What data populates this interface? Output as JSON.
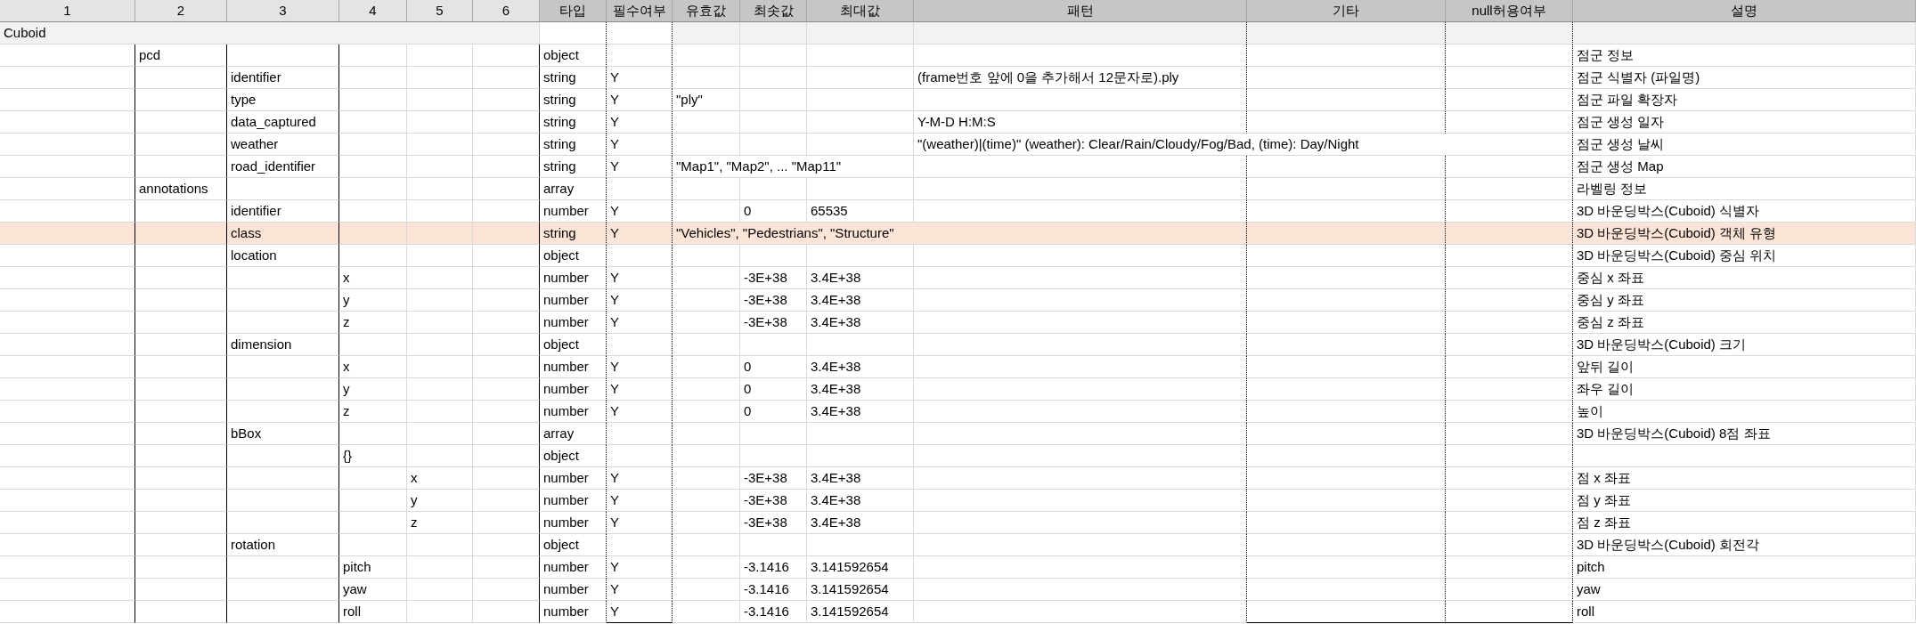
{
  "columns": [
    "1",
    "2",
    "3",
    "4",
    "5",
    "6",
    "타입",
    "필수여부",
    "유효값",
    "최솟값",
    "최대값",
    "패턴",
    "기타",
    "null허용여부",
    "설명"
  ],
  "section": {
    "title": "Cuboid",
    "children": [
      {
        "name": "pcd",
        "type": "object",
        "selected": false,
        "description": "점군 정보",
        "children": [
          {
            "name": "identifier",
            "type": "string",
            "required": "Y",
            "pattern": "(frame번호 앞에 0을 추가해서 12문자로).ply",
            "description": "점군 식별자 (파일명)",
            "selected": false
          },
          {
            "name": "type",
            "type": "string",
            "required": "Y",
            "valid": "\"ply\"",
            "description": "점군 파일 확장자",
            "selected": false
          },
          {
            "name": "data_captured",
            "type": "string",
            "required": "Y",
            "pattern": "Y-M-D H:M:S",
            "description": "점군 생성 일자",
            "selected": false
          },
          {
            "name": "weather",
            "type": "string",
            "required": "Y",
            "pattern": "\"(weather)|(time)\"   (weather): Clear/Rain/Cloudy/Fog/Bad, (time): Day/Night",
            "description": "점군 생성 날씨",
            "selected": false
          },
          {
            "name": "road_identifier",
            "type": "string",
            "required": "Y",
            "valid": "\"Map1\", \"Map2\", ... \"Map11\"",
            "description": "점군 생성 Map",
            "selected": false
          }
        ]
      },
      {
        "name": "annotations",
        "type": "array",
        "selected": false,
        "description": "라벨링 정보",
        "children": [
          {
            "name": "identifier",
            "type": "number",
            "required": "Y",
            "min": "0",
            "max": "65535",
            "description": "3D 바운딩박스(Cuboid) 식별자",
            "selected": false
          },
          {
            "name": "class",
            "type": "string",
            "required": "Y",
            "valid": "\"Vehicles\", \"Pedestrians\", \"Structure\"",
            "description": "3D 바운딩박스(Cuboid) 객체 유형",
            "selected": true
          },
          {
            "name": "location",
            "type": "object",
            "description": "3D 바운딩박스(Cuboid) 중심 위치",
            "selected": false,
            "children": [
              {
                "name": "x",
                "type": "number",
                "required": "Y",
                "min": "-3E+38",
                "max": "3.4E+38",
                "description": "중심 x 좌표",
                "selected": false
              },
              {
                "name": "y",
                "type": "number",
                "required": "Y",
                "min": "-3E+38",
                "max": "3.4E+38",
                "description": "중심 y 좌표",
                "selected": false
              },
              {
                "name": "z",
                "type": "number",
                "required": "Y",
                "min": "-3E+38",
                "max": "3.4E+38",
                "description": "중심 z 좌표",
                "selected": false
              }
            ]
          },
          {
            "name": "dimension",
            "type": "object",
            "description": "3D 바운딩박스(Cuboid) 크기",
            "selected": false,
            "children": [
              {
                "name": "x",
                "type": "number",
                "required": "Y",
                "min": "0",
                "max": "3.4E+38",
                "description": "앞뒤 길이",
                "selected": false
              },
              {
                "name": "y",
                "type": "number",
                "required": "Y",
                "min": "0",
                "max": "3.4E+38",
                "description": "좌우 길이",
                "selected": false
              },
              {
                "name": "z",
                "type": "number",
                "required": "Y",
                "min": "0",
                "max": "3.4E+38",
                "description": "높이",
                "selected": false
              }
            ]
          },
          {
            "name": "bBox",
            "type": "array",
            "description": "3D 바운딩박스(Cuboid) 8점 좌표",
            "selected": false,
            "children": [
              {
                "name": "{}",
                "type": "object",
                "selected": false,
                "children": [
                  {
                    "name": "x",
                    "type": "number",
                    "required": "Y",
                    "min": "-3E+38",
                    "max": "3.4E+38",
                    "description": "점 x 좌표",
                    "selected": false
                  },
                  {
                    "name": "y",
                    "type": "number",
                    "required": "Y",
                    "min": "-3E+38",
                    "max": "3.4E+38",
                    "description": "점 y 좌표",
                    "selected": false
                  },
                  {
                    "name": "z",
                    "type": "number",
                    "required": "Y",
                    "min": "-3E+38",
                    "max": "3.4E+38",
                    "description": "점 z 좌표",
                    "selected": false
                  }
                ]
              }
            ]
          },
          {
            "name": "rotation",
            "type": "object",
            "description": "3D 바운딩박스(Cuboid) 회전각",
            "selected": false,
            "children": [
              {
                "name": "pitch",
                "type": "number",
                "required": "Y",
                "min": "-3.1416",
                "max": "3.141592654",
                "description": "pitch",
                "selected": false
              },
              {
                "name": "yaw",
                "type": "number",
                "required": "Y",
                "min": "-3.1416",
                "max": "3.141592654",
                "description": "yaw",
                "selected": false
              },
              {
                "name": "roll",
                "type": "number",
                "required": "Y",
                "min": "-3.1416",
                "max": "3.141592654",
                "description": "roll",
                "selected": false
              }
            ]
          }
        ]
      }
    ]
  }
}
